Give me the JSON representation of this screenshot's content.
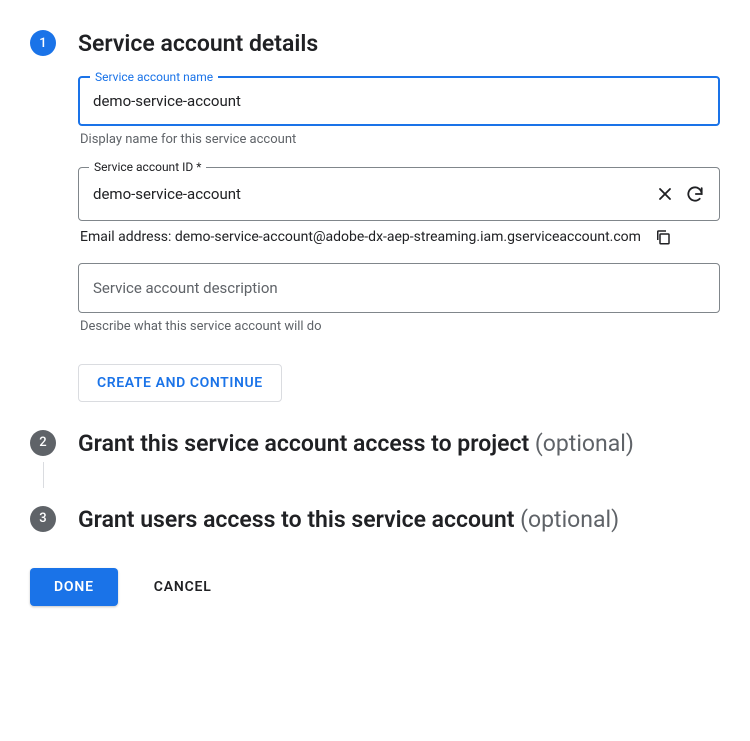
{
  "steps": {
    "s1": {
      "number": "1",
      "title": "Service account details",
      "name_field": {
        "label": "Service account name",
        "value": "demo-service-account",
        "helper": "Display name for this service account"
      },
      "id_field": {
        "label": "Service account ID *",
        "value": "demo-service-account"
      },
      "email_prefix": "Email address: ",
      "email_value": "demo-service-account@adobe-dx-aep-streaming.iam.gserviceaccount.com",
      "desc_field": {
        "placeholder": "Service account description",
        "value": "",
        "helper": "Describe what this service account will do"
      },
      "continue_label": "CREATE AND CONTINUE"
    },
    "s2": {
      "number": "2",
      "title": "Grant this service account access to project ",
      "optional": "(optional)"
    },
    "s3": {
      "number": "3",
      "title": "Grant users access to this service account ",
      "optional": "(optional)"
    }
  },
  "buttons": {
    "done": "DONE",
    "cancel": "CANCEL"
  }
}
